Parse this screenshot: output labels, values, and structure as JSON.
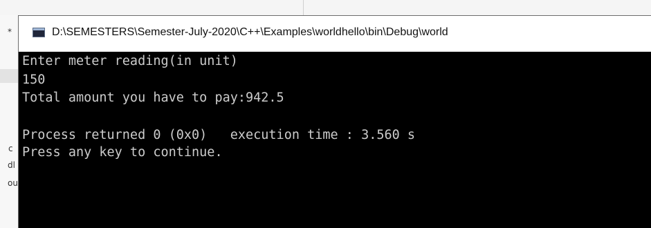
{
  "background": {
    "left_fragments": [
      "*",
      "c",
      "dl",
      "ou"
    ]
  },
  "console": {
    "icon": "console-window-icon",
    "title": "D:\\SEMESTERS\\Semester-July-2020\\C++\\Examples\\worldhello\\bin\\Debug\\world",
    "lines": [
      "Enter meter reading(in unit)",
      "150",
      "Total amount you have to pay:942.5",
      "",
      "Process returned 0 (0x0)   execution time : 3.560 s",
      "Press any key to continue."
    ]
  },
  "colors": {
    "console_bg": "#000000",
    "console_text": "#cccccc",
    "titlebar_bg": "#ffffff"
  }
}
